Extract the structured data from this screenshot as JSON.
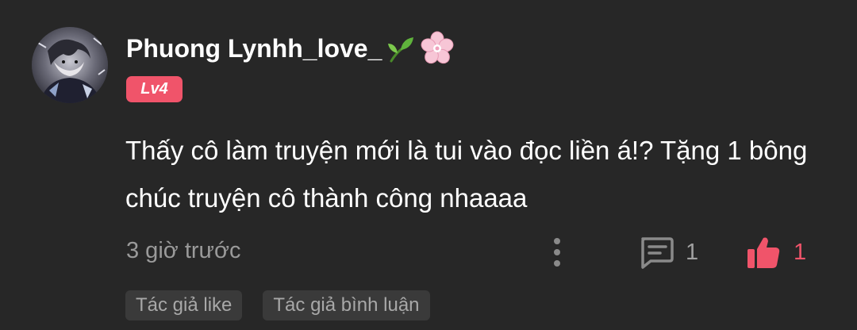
{
  "user": {
    "name": "Phuong Lynhh_love_",
    "level": "Lv4",
    "avatar_icon": "avatar-image",
    "name_emojis": [
      "seedling-icon",
      "cherry-blossom-icon"
    ]
  },
  "comment": {
    "text": "Thấy cô làm truyện mới là tui vào đọc liền á!? Tặng 1 bông chúc truyện cô thành công nhaaaa"
  },
  "meta": {
    "timestamp": "3 giờ trước",
    "replies_count": "1",
    "likes_count": "1"
  },
  "tags": [
    {
      "label": "Tác giả like"
    },
    {
      "label": "Tác giả bình luận"
    }
  ],
  "colors": {
    "background": "#272727",
    "accent": "#f0546a",
    "muted_text": "#9a9a9a",
    "tag_background": "#3a3a3a"
  },
  "icons": {
    "more": "vertical-dots-icon",
    "reply": "comment-bubble-icon",
    "like": "thumbs-up-icon"
  }
}
